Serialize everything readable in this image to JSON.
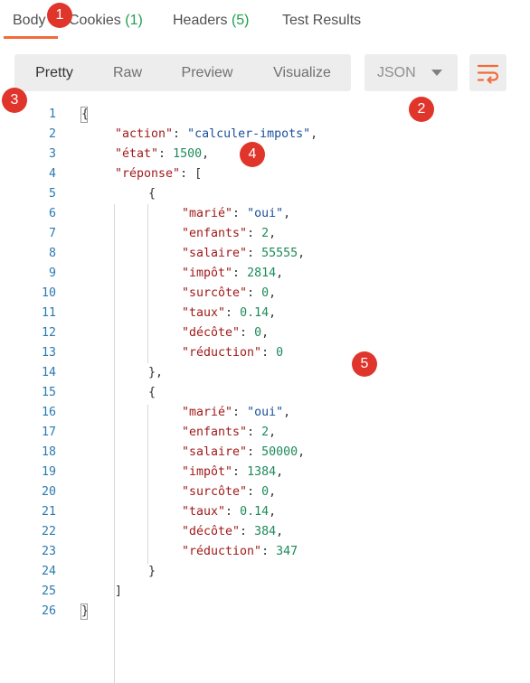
{
  "tabs": [
    {
      "label": "Body",
      "count": ""
    },
    {
      "label": "Cookies",
      "count": "(1)"
    },
    {
      "label": "Headers",
      "count": "(5)"
    },
    {
      "label": "Test Results",
      "count": ""
    }
  ],
  "toolbar": {
    "modes": [
      "Pretty",
      "Raw",
      "Preview",
      "Visualize"
    ],
    "active_mode": "Pretty",
    "format": "JSON"
  },
  "badges": [
    "1",
    "2",
    "3",
    "4",
    "5"
  ],
  "colors": {
    "accent": "#f26b3a",
    "badge": "#e0352b",
    "key": "#a11a1a",
    "string": "#1a4f9c",
    "number": "#1d8a5a",
    "line_number": "#2a7ab0"
  },
  "code_lines": [
    {
      "n": "1",
      "indent": 0,
      "tokens": [
        [
          "p",
          "{"
        ]
      ]
    },
    {
      "n": "2",
      "indent": 1,
      "tokens": [
        [
          "k",
          "\"action\""
        ],
        [
          "p",
          ": "
        ],
        [
          "s",
          "\"calculer-impots\""
        ],
        [
          "p",
          ","
        ]
      ]
    },
    {
      "n": "3",
      "indent": 1,
      "tokens": [
        [
          "k",
          "\"état\""
        ],
        [
          "p",
          ": "
        ],
        [
          "n",
          "1500"
        ],
        [
          "p",
          ","
        ]
      ]
    },
    {
      "n": "4",
      "indent": 1,
      "tokens": [
        [
          "k",
          "\"réponse\""
        ],
        [
          "p",
          ": ["
        ]
      ]
    },
    {
      "n": "5",
      "indent": 2,
      "tokens": [
        [
          "p",
          "{"
        ]
      ]
    },
    {
      "n": "6",
      "indent": 3,
      "tokens": [
        [
          "k",
          "\"marié\""
        ],
        [
          "p",
          ": "
        ],
        [
          "s",
          "\"oui\""
        ],
        [
          "p",
          ","
        ]
      ]
    },
    {
      "n": "7",
      "indent": 3,
      "tokens": [
        [
          "k",
          "\"enfants\""
        ],
        [
          "p",
          ": "
        ],
        [
          "n",
          "2"
        ],
        [
          "p",
          ","
        ]
      ]
    },
    {
      "n": "8",
      "indent": 3,
      "tokens": [
        [
          "k",
          "\"salaire\""
        ],
        [
          "p",
          ": "
        ],
        [
          "n",
          "55555"
        ],
        [
          "p",
          ","
        ]
      ]
    },
    {
      "n": "9",
      "indent": 3,
      "tokens": [
        [
          "k",
          "\"impôt\""
        ],
        [
          "p",
          ": "
        ],
        [
          "n",
          "2814"
        ],
        [
          "p",
          ","
        ]
      ]
    },
    {
      "n": "10",
      "indent": 3,
      "tokens": [
        [
          "k",
          "\"surcôte\""
        ],
        [
          "p",
          ": "
        ],
        [
          "n",
          "0"
        ],
        [
          "p",
          ","
        ]
      ]
    },
    {
      "n": "11",
      "indent": 3,
      "tokens": [
        [
          "k",
          "\"taux\""
        ],
        [
          "p",
          ": "
        ],
        [
          "n",
          "0.14"
        ],
        [
          "p",
          ","
        ]
      ]
    },
    {
      "n": "12",
      "indent": 3,
      "tokens": [
        [
          "k",
          "\"décôte\""
        ],
        [
          "p",
          ": "
        ],
        [
          "n",
          "0"
        ],
        [
          "p",
          ","
        ]
      ]
    },
    {
      "n": "13",
      "indent": 3,
      "tokens": [
        [
          "k",
          "\"réduction\""
        ],
        [
          "p",
          ": "
        ],
        [
          "n",
          "0"
        ]
      ]
    },
    {
      "n": "14",
      "indent": 2,
      "tokens": [
        [
          "p",
          "},"
        ]
      ]
    },
    {
      "n": "15",
      "indent": 2,
      "tokens": [
        [
          "p",
          "{"
        ]
      ]
    },
    {
      "n": "16",
      "indent": 3,
      "tokens": [
        [
          "k",
          "\"marié\""
        ],
        [
          "p",
          ": "
        ],
        [
          "s",
          "\"oui\""
        ],
        [
          "p",
          ","
        ]
      ]
    },
    {
      "n": "17",
      "indent": 3,
      "tokens": [
        [
          "k",
          "\"enfants\""
        ],
        [
          "p",
          ": "
        ],
        [
          "n",
          "2"
        ],
        [
          "p",
          ","
        ]
      ]
    },
    {
      "n": "18",
      "indent": 3,
      "tokens": [
        [
          "k",
          "\"salaire\""
        ],
        [
          "p",
          ": "
        ],
        [
          "n",
          "50000"
        ],
        [
          "p",
          ","
        ]
      ]
    },
    {
      "n": "19",
      "indent": 3,
      "tokens": [
        [
          "k",
          "\"impôt\""
        ],
        [
          "p",
          ": "
        ],
        [
          "n",
          "1384"
        ],
        [
          "p",
          ","
        ]
      ]
    },
    {
      "n": "20",
      "indent": 3,
      "tokens": [
        [
          "k",
          "\"surcôte\""
        ],
        [
          "p",
          ": "
        ],
        [
          "n",
          "0"
        ],
        [
          "p",
          ","
        ]
      ]
    },
    {
      "n": "21",
      "indent": 3,
      "tokens": [
        [
          "k",
          "\"taux\""
        ],
        [
          "p",
          ": "
        ],
        [
          "n",
          "0.14"
        ],
        [
          "p",
          ","
        ]
      ]
    },
    {
      "n": "22",
      "indent": 3,
      "tokens": [
        [
          "k",
          "\"décôte\""
        ],
        [
          "p",
          ": "
        ],
        [
          "n",
          "384"
        ],
        [
          "p",
          ","
        ]
      ]
    },
    {
      "n": "23",
      "indent": 3,
      "tokens": [
        [
          "k",
          "\"réduction\""
        ],
        [
          "p",
          ": "
        ],
        [
          "n",
          "347"
        ]
      ]
    },
    {
      "n": "24",
      "indent": 2,
      "tokens": [
        [
          "p",
          "}"
        ]
      ]
    },
    {
      "n": "25",
      "indent": 1,
      "tokens": [
        [
          "p",
          "]"
        ]
      ]
    },
    {
      "n": "26",
      "indent": 0,
      "tokens": [
        [
          "p",
          "}"
        ]
      ]
    }
  ]
}
